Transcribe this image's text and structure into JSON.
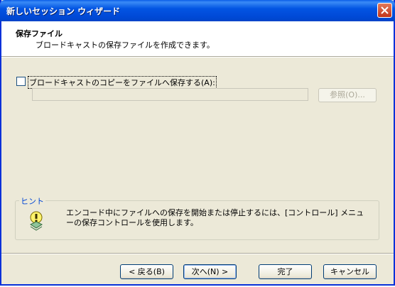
{
  "window": {
    "title": "新しいセッション ウィザード"
  },
  "header": {
    "title": "保存ファイル",
    "subtitle": "ブロードキャストの保存ファイルを作成できます。"
  },
  "save_copy": {
    "label": "ブロードキャストのコピーをファイルへ保存する(A):",
    "checked": false
  },
  "path_field": {
    "value": ""
  },
  "browse_button": {
    "label": "参照(O)..."
  },
  "hint": {
    "legend": "ヒント",
    "text": "エンコード中にファイルへの保存を開始または停止するには、[コントロール] メニューの保存コントロールを使用します。"
  },
  "buttons": {
    "back": "< 戻る(B)",
    "next": "次へ(N) >",
    "finish": "完了",
    "cancel": "キャンセル"
  },
  "colors": {
    "titlebar": "#0055e3",
    "dialog_bg": "#ece9d8",
    "hint_legend": "#0046d5"
  }
}
